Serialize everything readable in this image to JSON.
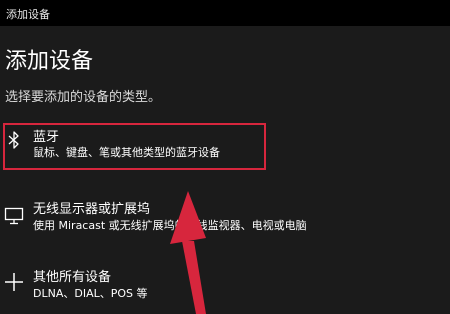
{
  "window": {
    "title": "添加设备"
  },
  "dialog": {
    "heading": "添加设备",
    "subheading": "选择要添加的设备的类型。",
    "options": [
      {
        "icon": "bluetooth-icon",
        "title": "蓝牙",
        "description": "鼠标、键盘、笔或其他类型的蓝牙设备"
      },
      {
        "icon": "monitor-icon",
        "title": "无线显示器或扩展坞",
        "description": "使用 Miracast 或无线扩展坞的无线监视器、电视或电脑"
      },
      {
        "icon": "plus-icon",
        "title": "其他所有设备",
        "description": "DLNA、DIAL、POS 等"
      }
    ]
  },
  "annotation": {
    "color": "#d7263d"
  }
}
